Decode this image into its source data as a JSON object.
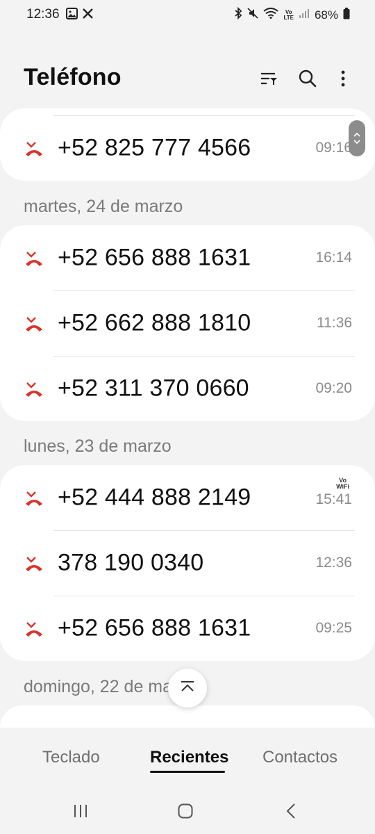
{
  "status_bar": {
    "time": "12:36",
    "battery": "68%",
    "volte_top": "Vo",
    "volte_bottom": "LTE"
  },
  "header": {
    "title": "Teléfono",
    "icons": [
      "filter-icon",
      "search-icon",
      "more-options-icon"
    ]
  },
  "colors": {
    "missed_call": "#d9342b",
    "time_text": "#8a8a8a",
    "date_header": "#7a7a7a"
  },
  "groups": [
    {
      "date": "",
      "calls": [
        {
          "number": "+52 825 777 4566",
          "time": "09:16",
          "type": "missed"
        }
      ]
    },
    {
      "date": "martes, 24 de marzo",
      "calls": [
        {
          "number": "+52 656 888 1631",
          "time": "16:14",
          "type": "missed"
        },
        {
          "number": "+52 662 888 1810",
          "time": "11:36",
          "type": "missed"
        },
        {
          "number": "+52 311 370 0660",
          "time": "09:20",
          "type": "missed"
        }
      ]
    },
    {
      "date": "lunes, 23 de marzo",
      "calls": [
        {
          "number": "+52 444 888 2149",
          "time": "15:41",
          "type": "missed",
          "badge_top": "Vo",
          "badge_bottom": "WiFi"
        },
        {
          "number": "378 190 0340",
          "time": "12:36",
          "type": "missed"
        },
        {
          "number": "+52 656 888 1631",
          "time": "09:25",
          "type": "missed"
        }
      ]
    },
    {
      "date": "domingo, 22 de marzo",
      "calls": []
    }
  ],
  "tabs": {
    "keypad": "Teclado",
    "recents": "Recientes",
    "contacts": "Contactos",
    "active": "Recientes"
  }
}
